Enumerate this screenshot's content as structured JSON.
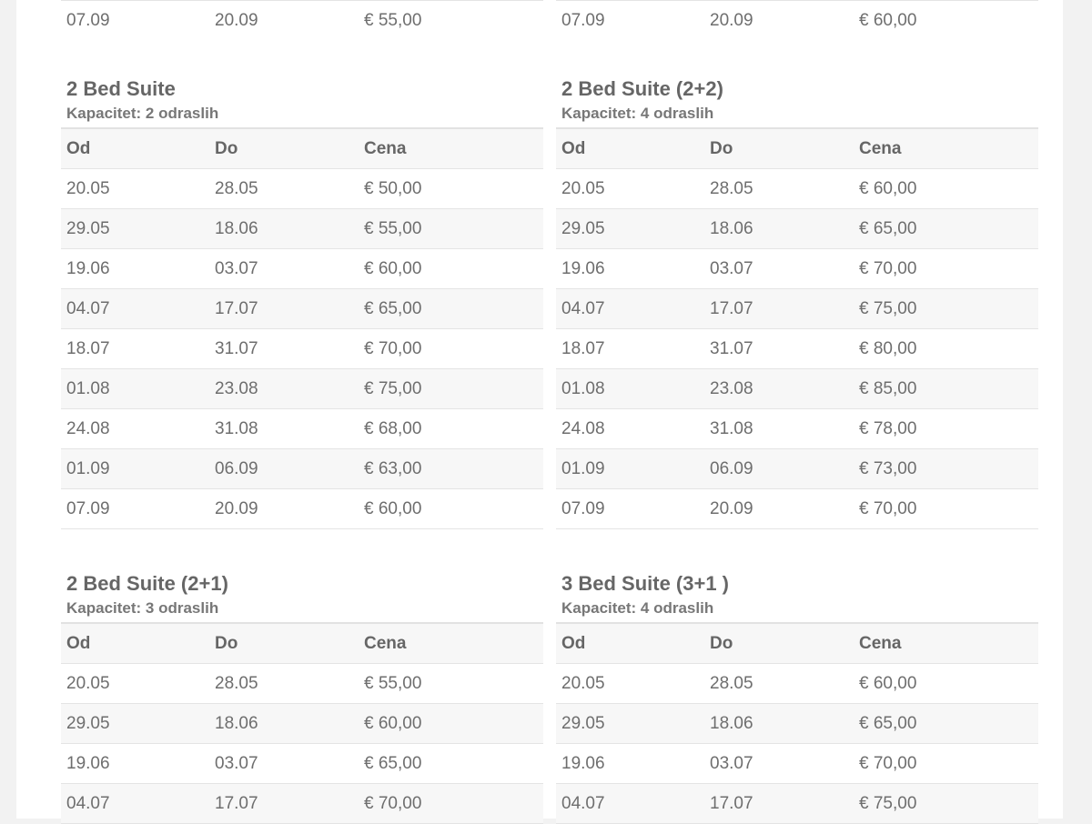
{
  "top_rows": {
    "left": [
      "07.09",
      "20.09",
      "€ 55,00"
    ],
    "right": [
      "07.09",
      "20.09",
      "€ 60,00"
    ]
  },
  "headers": {
    "from": "Od",
    "to": "Do",
    "price": "Cena"
  },
  "sections": [
    {
      "title": "2 Bed Suite",
      "capacity": "Kapacitet: 2 odraslih",
      "rows": [
        [
          "20.05",
          "28.05",
          "€ 50,00"
        ],
        [
          "29.05",
          "18.06",
          "€ 55,00"
        ],
        [
          "19.06",
          "03.07",
          "€ 60,00"
        ],
        [
          "04.07",
          "17.07",
          "€ 65,00"
        ],
        [
          "18.07",
          "31.07",
          "€ 70,00"
        ],
        [
          "01.08",
          "23.08",
          "€ 75,00"
        ],
        [
          "24.08",
          "31.08",
          "€ 68,00"
        ],
        [
          "01.09",
          "06.09",
          "€ 63,00"
        ],
        [
          "07.09",
          "20.09",
          "€ 60,00"
        ]
      ]
    },
    {
      "title": "2 Bed Suite (2+2)",
      "capacity": "Kapacitet: 4 odraslih",
      "rows": [
        [
          "20.05",
          "28.05",
          "€ 60,00"
        ],
        [
          "29.05",
          "18.06",
          "€ 65,00"
        ],
        [
          "19.06",
          "03.07",
          "€ 70,00"
        ],
        [
          "04.07",
          "17.07",
          "€ 75,00"
        ],
        [
          "18.07",
          "31.07",
          "€ 80,00"
        ],
        [
          "01.08",
          "23.08",
          "€ 85,00"
        ],
        [
          "24.08",
          "31.08",
          "€ 78,00"
        ],
        [
          "01.09",
          "06.09",
          "€ 73,00"
        ],
        [
          "07.09",
          "20.09",
          "€ 70,00"
        ]
      ]
    },
    {
      "title": "2 Bed Suite (2+1)",
      "capacity": "Kapacitet: 3 odraslih",
      "rows": [
        [
          "20.05",
          "28.05",
          "€ 55,00"
        ],
        [
          "29.05",
          "18.06",
          "€ 60,00"
        ],
        [
          "19.06",
          "03.07",
          "€ 65,00"
        ],
        [
          "04.07",
          "17.07",
          "€ 70,00"
        ]
      ]
    },
    {
      "title": "3 Bed Suite (3+1 )",
      "capacity": "Kapacitet: 4 odraslih",
      "rows": [
        [
          "20.05",
          "28.05",
          "€ 60,00"
        ],
        [
          "29.05",
          "18.06",
          "€ 65,00"
        ],
        [
          "19.06",
          "03.07",
          "€ 70,00"
        ],
        [
          "04.07",
          "17.07",
          "€ 75,00"
        ]
      ]
    }
  ]
}
